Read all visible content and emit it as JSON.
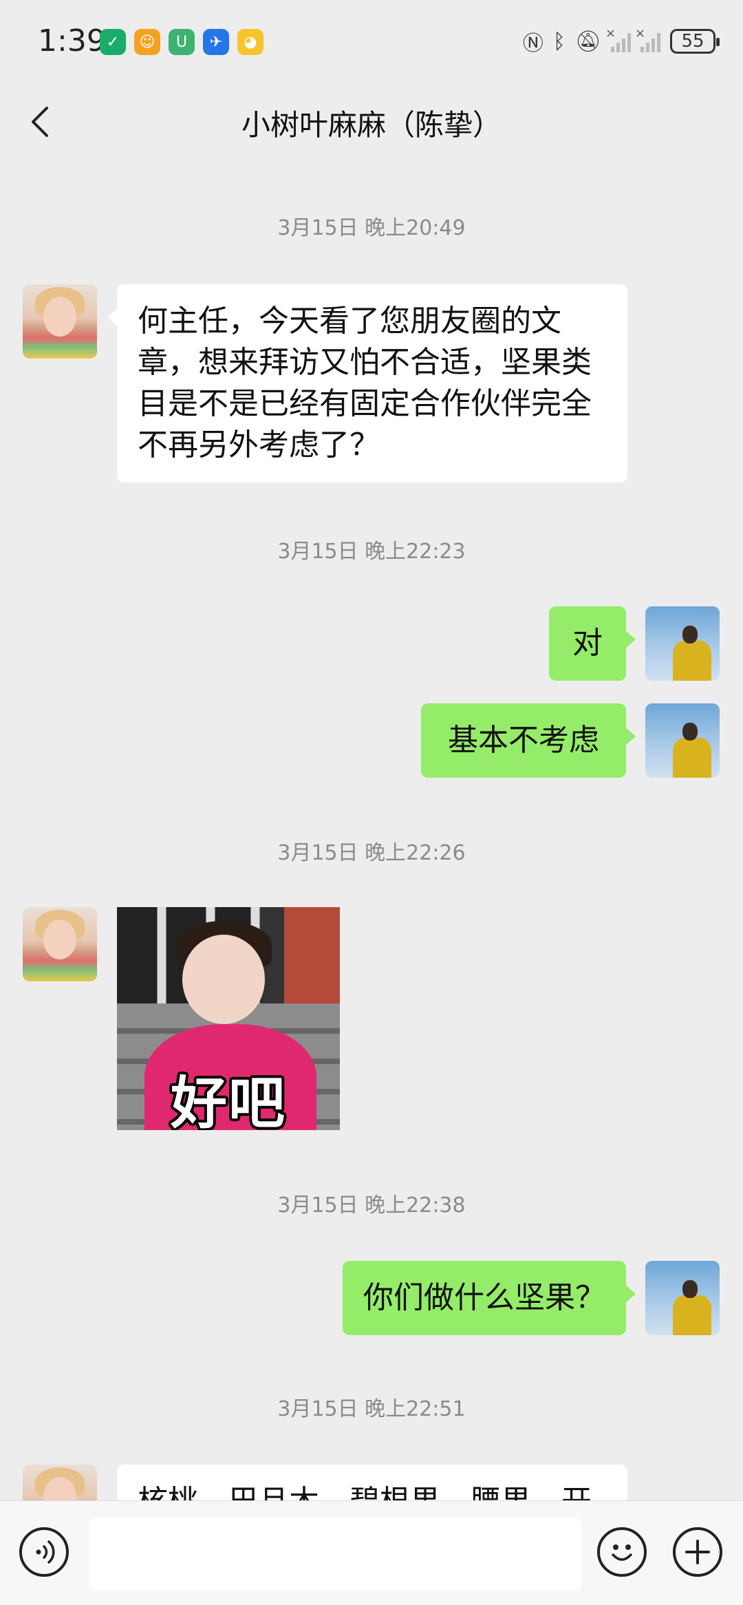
{
  "status_bar": {
    "time": "1:39",
    "battery": "55",
    "app_icons": [
      {
        "name": "green-circle-app-icon",
        "glyph": "✓",
        "color": "#1aad6a"
      },
      {
        "name": "orange-chick-app-icon",
        "glyph": "☺",
        "color": "#f4a321"
      },
      {
        "name": "green-u-app-icon",
        "glyph": "U",
        "color": "#3cb371"
      },
      {
        "name": "blue-plane-app-icon",
        "glyph": "✈",
        "color": "#2475e8"
      },
      {
        "name": "yellow-duck-app-icon",
        "glyph": "◕",
        "color": "#f7c42e"
      }
    ]
  },
  "header": {
    "title": "小树叶麻麻（陈挚）"
  },
  "messages": [
    {
      "type": "timestamp",
      "text": "3月15日 晚上20:49"
    },
    {
      "type": "text",
      "side": "in",
      "text": "何主任，今天看了您朋友圈的文章，想来拜访又怕不合适，坚果类目是不是已经有固定合作伙伴完全不再另外考虑了？"
    },
    {
      "type": "timestamp",
      "text": "3月15日 晚上22:23"
    },
    {
      "type": "text",
      "side": "out",
      "text": "对"
    },
    {
      "type": "text",
      "side": "out",
      "text": "基本不考虑"
    },
    {
      "type": "timestamp",
      "text": "3月15日 晚上22:26"
    },
    {
      "type": "sticker",
      "side": "in",
      "caption": "好吧"
    },
    {
      "type": "timestamp",
      "text": "3月15日 晚上22:38"
    },
    {
      "type": "text",
      "side": "out",
      "text": "你们做什么坚果？"
    },
    {
      "type": "timestamp",
      "text": "3月15日 晚上22:51"
    },
    {
      "type": "text",
      "side": "in",
      "text": "核桃、巴旦木、碧根果、腰果、开"
    }
  ],
  "input_bar": {
    "placeholder": ""
  }
}
